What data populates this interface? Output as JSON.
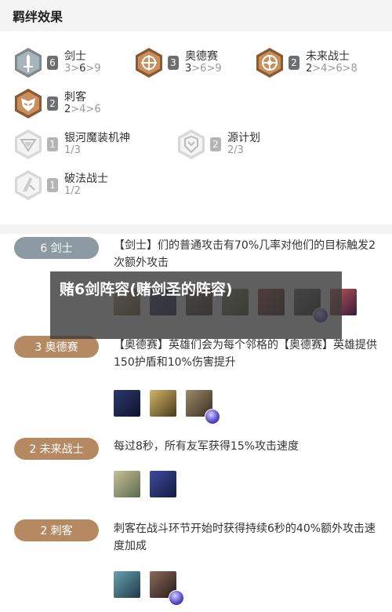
{
  "header": {
    "title": "羁绊效果"
  },
  "bonds": [
    [
      {
        "name": "剑士",
        "count": "6",
        "active": true,
        "prog_pre": "3>",
        "prog_hi": "6",
        "prog_post": ">9",
        "icon": "sword-icon"
      },
      {
        "name": "奥德赛",
        "count": "3",
        "active": true,
        "prog_pre": "",
        "prog_hi": "3",
        "prog_post": ">6>9",
        "icon": "odyssey-icon"
      },
      {
        "name": "未来战士",
        "count": "2",
        "active": true,
        "prog_pre": "",
        "prog_hi": "2",
        "prog_post": ">4>6>8",
        "icon": "future-icon"
      }
    ],
    [
      {
        "name": "刺客",
        "count": "2",
        "active": true,
        "prog_pre": "",
        "prog_hi": "2",
        "prog_post": ">4>6",
        "icon": "assassin-icon"
      }
    ],
    [
      {
        "name": "银河魔装机神",
        "count": "1",
        "active": false,
        "prog_pre": "1/3",
        "prog_hi": "",
        "prog_post": "",
        "icon": "mech-icon"
      },
      {
        "name": "源计划",
        "count": "2",
        "active": false,
        "prog_pre": "2/3",
        "prog_hi": "",
        "prog_post": "",
        "icon": "project-icon"
      }
    ],
    [
      {
        "name": "破法战士",
        "count": "1",
        "active": false,
        "prog_pre": "1/2",
        "prog_hi": "",
        "prog_post": "",
        "icon": "spellblade-icon"
      }
    ]
  ],
  "details": [
    {
      "label": "6 剑士",
      "desc": "【剑士】们的普通攻击有70%几率对他们的目标触发2次额外攻击"
    },
    {
      "label": "3 奥德赛",
      "desc": "【奥德赛】英雄们会为每个邻格的【奥德赛】英雄提供150护盾和10%伤害提升"
    },
    {
      "label": "2 未来战士",
      "desc": "每过8秒，所有友军获得15%攻击速度"
    },
    {
      "label": "2 刺客",
      "desc": "刺客在战斗环节开始时获得持续6秒的40%额外攻击速度加成"
    }
  ],
  "overlay": {
    "title": "赌6剑阵容(赌剑圣的阵容)"
  }
}
